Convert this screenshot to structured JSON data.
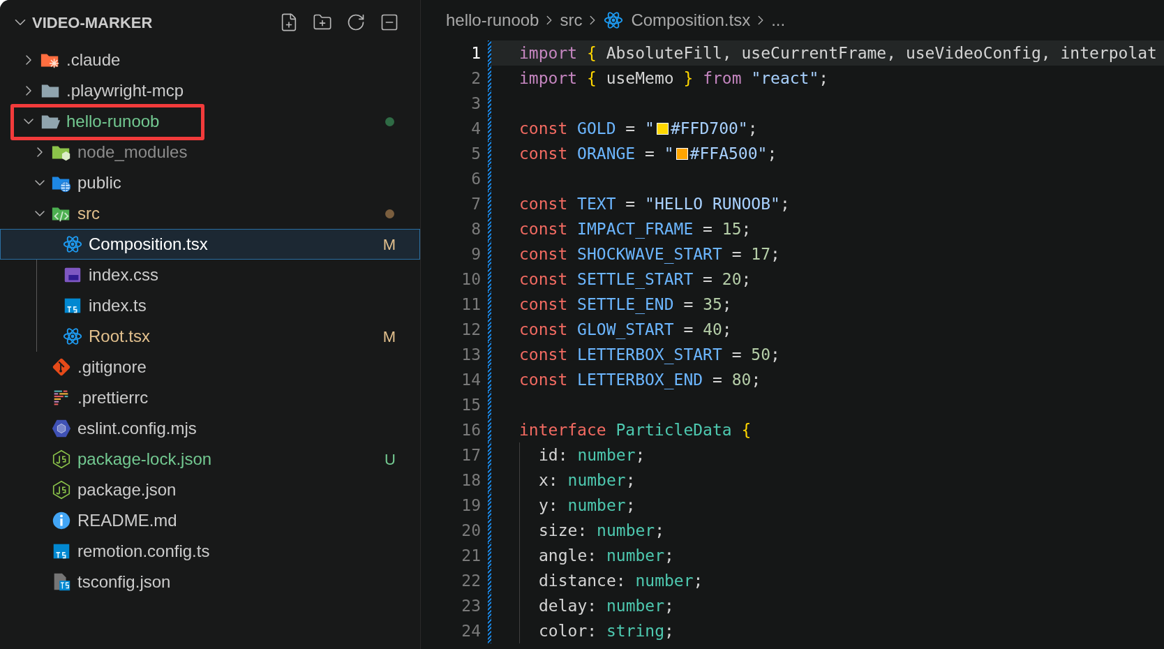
{
  "explorer": {
    "title": "VIDEO-MARKER",
    "expanded": true,
    "items": [
      {
        "name": ".claude",
        "kind": "folder-claude",
        "expanded": false,
        "selected": false
      },
      {
        "name": ".playwright-mcp",
        "kind": "folder",
        "expanded": false,
        "selected": false
      },
      {
        "name": "hello-runoob",
        "kind": "folder",
        "expanded": true,
        "selected": false,
        "untracked": true,
        "dot": true,
        "annotated": true,
        "children": [
          {
            "name": "node_modules",
            "kind": "folder-node",
            "expanded": false,
            "selected": false,
            "ignored": true
          },
          {
            "name": "public",
            "kind": "folder-public",
            "expanded": true,
            "selected": false
          },
          {
            "name": "src",
            "kind": "folder-src",
            "expanded": true,
            "selected": false,
            "modified": true,
            "dot": true,
            "children": [
              {
                "name": "Composition.tsx",
                "kind": "react",
                "selected": true,
                "modified": true,
                "badge": "M"
              },
              {
                "name": "index.css",
                "kind": "css",
                "selected": false
              },
              {
                "name": "index.ts",
                "kind": "ts",
                "selected": false
              },
              {
                "name": "Root.tsx",
                "kind": "react",
                "selected": false,
                "modified": true,
                "badge": "M"
              }
            ]
          },
          {
            "name": ".gitignore",
            "kind": "git",
            "selected": false
          },
          {
            "name": ".prettierrc",
            "kind": "prettier",
            "selected": false
          },
          {
            "name": "eslint.config.mjs",
            "kind": "eslint",
            "selected": false
          },
          {
            "name": "package-lock.json",
            "kind": "json",
            "selected": false,
            "untracked": true,
            "badge": "U"
          },
          {
            "name": "package.json",
            "kind": "json",
            "selected": false
          },
          {
            "name": "README.md",
            "kind": "info",
            "selected": false
          },
          {
            "name": "remotion.config.ts",
            "kind": "ts",
            "selected": false
          },
          {
            "name": "tsconfig.json",
            "kind": "tsconfig",
            "selected": false
          }
        ]
      }
    ]
  },
  "breadcrumbs": [
    {
      "text": "hello-runoob"
    },
    {
      "text": "src"
    },
    {
      "text": "Composition.tsx",
      "kind": "react"
    },
    {
      "text": "..."
    }
  ],
  "editor": {
    "lines": [
      {
        "number": "1",
        "current": true,
        "tokens": [
          {
            "kind": "keyword",
            "text": "import "
          },
          {
            "kind": "brace",
            "text": "{ "
          },
          {
            "kind": "plain",
            "text": "AbsoluteFill, useCurrentFrame, useVideoConfig, interpolat"
          }
        ]
      },
      {
        "number": "2",
        "current": false,
        "tokens": [
          {
            "kind": "keyword",
            "text": "import "
          },
          {
            "kind": "brace",
            "text": "{ "
          },
          {
            "kind": "plain",
            "text": "useMemo "
          },
          {
            "kind": "brace",
            "text": "} "
          },
          {
            "kind": "keyword",
            "text": "from "
          },
          {
            "kind": "string",
            "text": "\"react\""
          },
          {
            "kind": "plain",
            "text": ";"
          }
        ]
      },
      {
        "number": "3",
        "current": false
      },
      {
        "number": "4",
        "current": false,
        "tokens": [
          {
            "kind": "storage",
            "text": "const "
          },
          {
            "kind": "constant",
            "text": "GOLD "
          },
          {
            "kind": "plain",
            "text": "= "
          },
          {
            "kind": "string",
            "text": "\""
          },
          {
            "kind": "swatch",
            "color": "#ffd700"
          },
          {
            "kind": "string",
            "text": "#FFD700\""
          },
          {
            "kind": "plain",
            "text": ";"
          }
        ]
      },
      {
        "number": "5",
        "current": false,
        "tokens": [
          {
            "kind": "storage",
            "text": "const "
          },
          {
            "kind": "constant",
            "text": "ORANGE "
          },
          {
            "kind": "plain",
            "text": "= "
          },
          {
            "kind": "string",
            "text": "\""
          },
          {
            "kind": "swatch",
            "color": "#ffa500"
          },
          {
            "kind": "string",
            "text": "#FFA500\""
          },
          {
            "kind": "plain",
            "text": ";"
          }
        ]
      },
      {
        "number": "6",
        "current": false
      },
      {
        "number": "7",
        "current": false,
        "tokens": [
          {
            "kind": "storage",
            "text": "const "
          },
          {
            "kind": "constant",
            "text": "TEXT "
          },
          {
            "kind": "plain",
            "text": "= "
          },
          {
            "kind": "string",
            "text": "\"HELLO RUNOOB\""
          },
          {
            "kind": "plain",
            "text": ";"
          }
        ]
      },
      {
        "number": "8",
        "current": false,
        "tokens": [
          {
            "kind": "storage",
            "text": "const "
          },
          {
            "kind": "constant",
            "text": "IMPACT_FRAME "
          },
          {
            "kind": "plain",
            "text": "= "
          },
          {
            "kind": "number",
            "text": "15"
          },
          {
            "kind": "plain",
            "text": ";"
          }
        ]
      },
      {
        "number": "9",
        "current": false,
        "tokens": [
          {
            "kind": "storage",
            "text": "const "
          },
          {
            "kind": "constant",
            "text": "SHOCKWAVE_START "
          },
          {
            "kind": "plain",
            "text": "= "
          },
          {
            "kind": "number",
            "text": "17"
          },
          {
            "kind": "plain",
            "text": ";"
          }
        ]
      },
      {
        "number": "10",
        "current": false,
        "tokens": [
          {
            "kind": "storage",
            "text": "const "
          },
          {
            "kind": "constant",
            "text": "SETTLE_START "
          },
          {
            "kind": "plain",
            "text": "= "
          },
          {
            "kind": "number",
            "text": "20"
          },
          {
            "kind": "plain",
            "text": ";"
          }
        ]
      },
      {
        "number": "11",
        "current": false,
        "tokens": [
          {
            "kind": "storage",
            "text": "const "
          },
          {
            "kind": "constant",
            "text": "SETTLE_END "
          },
          {
            "kind": "plain",
            "text": "= "
          },
          {
            "kind": "number",
            "text": "35"
          },
          {
            "kind": "plain",
            "text": ";"
          }
        ]
      },
      {
        "number": "12",
        "current": false,
        "tokens": [
          {
            "kind": "storage",
            "text": "const "
          },
          {
            "kind": "constant",
            "text": "GLOW_START "
          },
          {
            "kind": "plain",
            "text": "= "
          },
          {
            "kind": "number",
            "text": "40"
          },
          {
            "kind": "plain",
            "text": ";"
          }
        ]
      },
      {
        "number": "13",
        "current": false,
        "tokens": [
          {
            "kind": "storage",
            "text": "const "
          },
          {
            "kind": "constant",
            "text": "LETTERBOX_START "
          },
          {
            "kind": "plain",
            "text": "= "
          },
          {
            "kind": "number",
            "text": "50"
          },
          {
            "kind": "plain",
            "text": ";"
          }
        ]
      },
      {
        "number": "14",
        "current": false,
        "tokens": [
          {
            "kind": "storage",
            "text": "const "
          },
          {
            "kind": "constant",
            "text": "LETTERBOX_END "
          },
          {
            "kind": "plain",
            "text": "= "
          },
          {
            "kind": "number",
            "text": "80"
          },
          {
            "kind": "plain",
            "text": ";"
          }
        ]
      },
      {
        "number": "15",
        "current": false
      },
      {
        "number": "16",
        "current": false,
        "tokens": [
          {
            "kind": "storage",
            "text": "interface "
          },
          {
            "kind": "type",
            "text": "ParticleData "
          },
          {
            "kind": "brace",
            "text": "{"
          }
        ]
      },
      {
        "number": "17",
        "current": false,
        "indented": true,
        "tokens": [
          {
            "kind": "plain",
            "text": "id: "
          },
          {
            "kind": "type",
            "text": "number"
          },
          {
            "kind": "plain",
            "text": ";"
          }
        ]
      },
      {
        "number": "18",
        "current": false,
        "indented": true,
        "tokens": [
          {
            "kind": "plain",
            "text": "x: "
          },
          {
            "kind": "type",
            "text": "number"
          },
          {
            "kind": "plain",
            "text": ";"
          }
        ]
      },
      {
        "number": "19",
        "current": false,
        "indented": true,
        "tokens": [
          {
            "kind": "plain",
            "text": "y: "
          },
          {
            "kind": "type",
            "text": "number"
          },
          {
            "kind": "plain",
            "text": ";"
          }
        ]
      },
      {
        "number": "20",
        "current": false,
        "indented": true,
        "tokens": [
          {
            "kind": "plain",
            "text": "size: "
          },
          {
            "kind": "type",
            "text": "number"
          },
          {
            "kind": "plain",
            "text": ";"
          }
        ]
      },
      {
        "number": "21",
        "current": false,
        "indented": true,
        "tokens": [
          {
            "kind": "plain",
            "text": "angle: "
          },
          {
            "kind": "type",
            "text": "number"
          },
          {
            "kind": "plain",
            "text": ";"
          }
        ]
      },
      {
        "number": "22",
        "current": false,
        "indented": true,
        "tokens": [
          {
            "kind": "plain",
            "text": "distance: "
          },
          {
            "kind": "type",
            "text": "number"
          },
          {
            "kind": "plain",
            "text": ";"
          }
        ]
      },
      {
        "number": "23",
        "current": false,
        "indented": true,
        "tokens": [
          {
            "kind": "plain",
            "text": "delay: "
          },
          {
            "kind": "type",
            "text": "number"
          },
          {
            "kind": "plain",
            "text": ";"
          }
        ]
      },
      {
        "number": "24",
        "current": false,
        "indented": true,
        "tokens": [
          {
            "kind": "plain",
            "text": "color: "
          },
          {
            "kind": "type",
            "text": "string"
          },
          {
            "kind": "plain",
            "text": ";"
          }
        ]
      }
    ]
  }
}
